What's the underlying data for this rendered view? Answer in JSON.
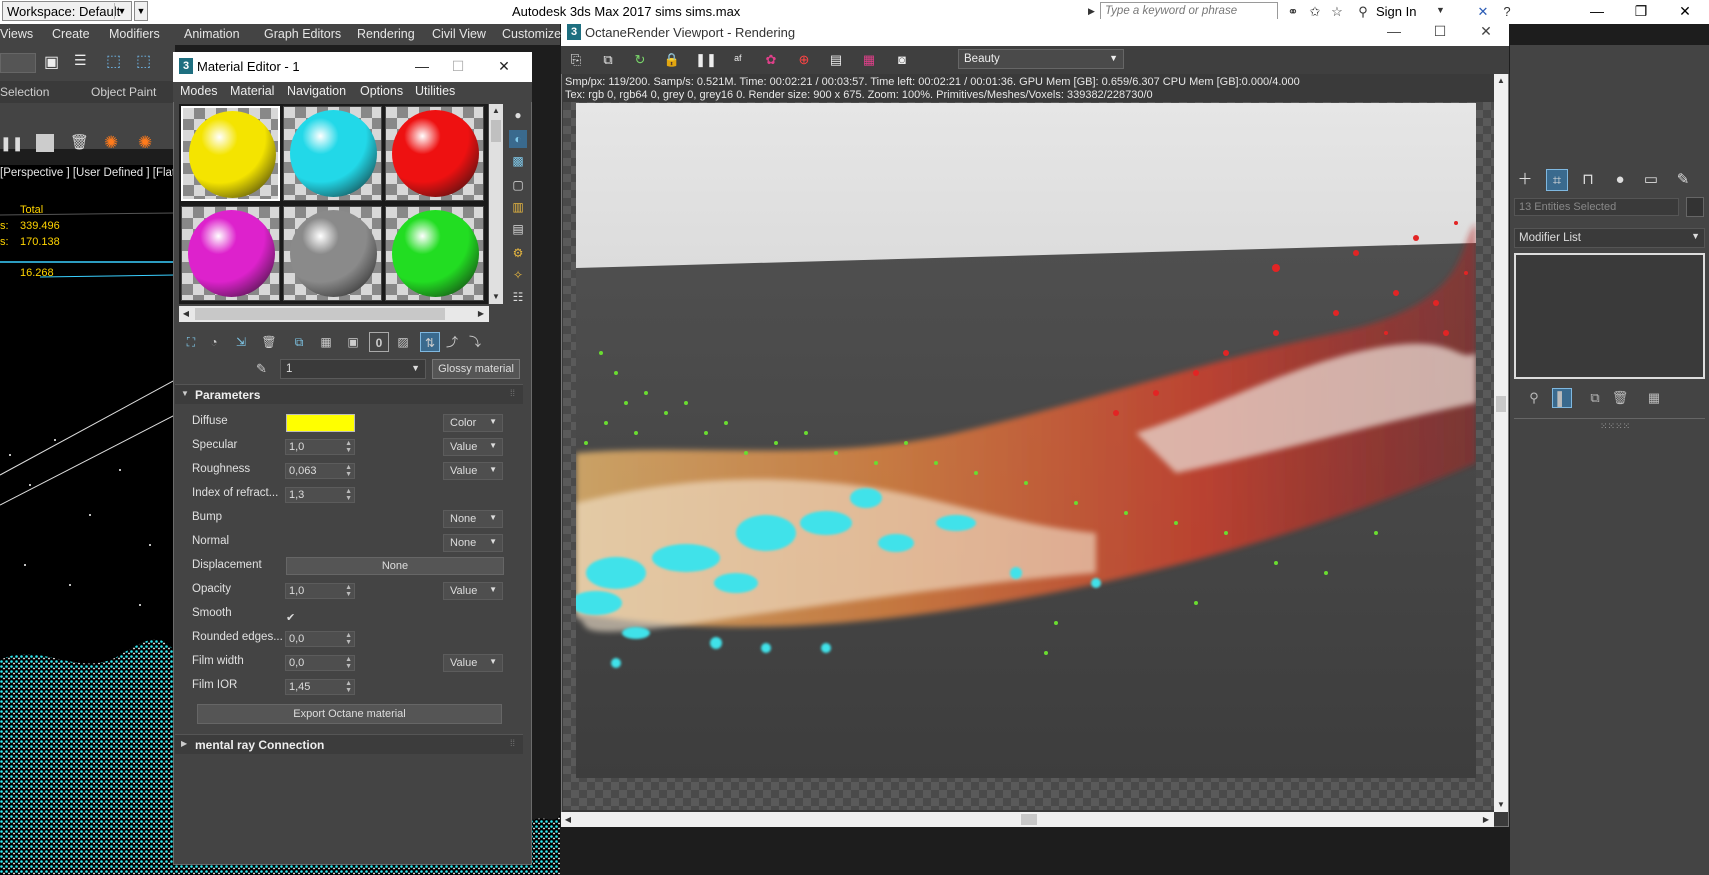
{
  "titlebar": {
    "workspace": "Workspace: Default",
    "app_title": "Autodesk 3ds Max 2017    sims sims.max",
    "search_placeholder": "Type a keyword or phrase",
    "sign_in": "Sign In"
  },
  "menubar": {
    "items": [
      "Views",
      "Create",
      "Modifiers",
      "Animation",
      "Graph Editors",
      "Rendering",
      "Civil View",
      "Customize"
    ]
  },
  "ribbon": {
    "selection": "Selection",
    "object_paint": "Object Paint"
  },
  "viewport": {
    "label": "[Perspective ] [User Defined ] [Flat C",
    "stats_total": "Total",
    "stats_row1_label": "s:",
    "stats_row1_value": "339.496",
    "stats_row2_label": "s:",
    "stats_row2_value": "170.138",
    "stats_row3_value": "16.268"
  },
  "command_panel": {
    "selection_field": "13 Entities Selected",
    "modifier_list": "Modifier List"
  },
  "material_editor": {
    "title": "Material Editor - 1",
    "menu": [
      "Modes",
      "Material",
      "Navigation",
      "Options",
      "Utilities"
    ],
    "slots": [
      {
        "color": "#f4e400"
      },
      {
        "color": "#22d8e8"
      },
      {
        "color": "#ee1111"
      },
      {
        "color": "#dd22cc"
      },
      {
        "color": "#8a8a8a"
      },
      {
        "color": "#22dd22"
      }
    ],
    "material_name": "1",
    "material_type": "Glossy material",
    "rollout_parameters": "Parameters",
    "rollout_mental_ray": "mental ray Connection",
    "params": {
      "diffuse": {
        "label": "Diffuse",
        "color": "#ffff00",
        "mode": "Color"
      },
      "specular": {
        "label": "Specular",
        "value": "1,0",
        "mode": "Value"
      },
      "roughness": {
        "label": "Roughness",
        "value": "0,063",
        "mode": "Value"
      },
      "ior": {
        "label": "Index of refract...",
        "value": "1,3"
      },
      "bump": {
        "label": "Bump",
        "mode": "None"
      },
      "normal": {
        "label": "Normal",
        "mode": "None"
      },
      "displacement": {
        "label": "Displacement",
        "button": "None"
      },
      "opacity": {
        "label": "Opacity",
        "value": "1,0",
        "mode": "Value"
      },
      "smooth": {
        "label": "Smooth",
        "check": "✔"
      },
      "rounded": {
        "label": "Rounded edges...",
        "value": "0,0"
      },
      "film_width": {
        "label": "Film width",
        "value": "0,0",
        "mode": "Value"
      },
      "film_ior": {
        "label": "Film IOR",
        "value": "1,45"
      }
    },
    "export_button": "Export Octane material"
  },
  "octane": {
    "title": "OctaneRender Viewport - Rendering",
    "render_pass": "Beauty",
    "stats_line1": "Smp/px: 119/200.   Samp/s: 0.521M.   Time: 00:02:21 / 00:03:57.   Time left: 00:02:21 / 00:01:36.   GPU Mem [GB]: 0.659/6.307   CPU Mem [GB]:0.000/4.000",
    "stats_line2": "Tex: rgb 0, rgb64 0, grey 0, grey16 0.   Render size: 900 x 675.   Zoom: 100%.   Primitives/Meshes/Voxels: 339382/228730/0"
  }
}
